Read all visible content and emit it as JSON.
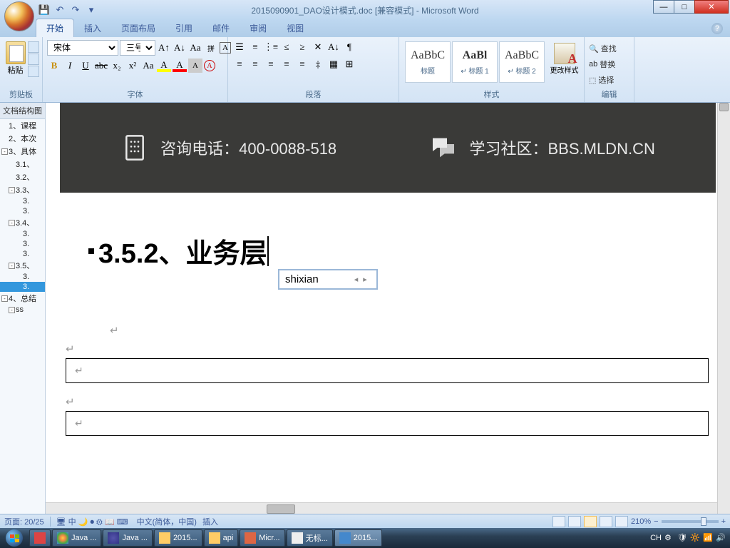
{
  "title": "2015090901_DAO设计模式.doc [兼容模式] - Microsoft Word",
  "ribbon": {
    "tabs": [
      "开始",
      "插入",
      "页面布局",
      "引用",
      "邮件",
      "审阅",
      "视图"
    ],
    "groups": {
      "clipboard": "剪贴板",
      "paste": "粘贴",
      "font": "字体",
      "paragraph": "段落",
      "styles": "样式",
      "editing": "编辑",
      "change_styles": "更改样式"
    },
    "font_name": "宋体",
    "font_size": "三号",
    "style_items": [
      {
        "preview": "AaBbC",
        "name": "标题"
      },
      {
        "preview": "AaBl",
        "name": "↵ 标题 1"
      },
      {
        "preview": "AaBbC",
        "name": "↵ 标题 2"
      }
    ],
    "find": "查找",
    "replace": "替换",
    "select": "选择"
  },
  "nav": {
    "title": "文档结构图",
    "items": [
      {
        "lvl": 0,
        "exp": "",
        "txt": "1、课程"
      },
      {
        "lvl": 0,
        "exp": "",
        "txt": "2、本次"
      },
      {
        "lvl": 0,
        "exp": "-",
        "txt": "3、具体"
      },
      {
        "lvl": 1,
        "exp": "",
        "txt": "3.1、"
      },
      {
        "lvl": 1,
        "exp": "",
        "txt": "3.2、"
      },
      {
        "lvl": 1,
        "exp": "-",
        "txt": "3.3、"
      },
      {
        "lvl": 2,
        "exp": "",
        "txt": "3."
      },
      {
        "lvl": 2,
        "exp": "",
        "txt": "3."
      },
      {
        "lvl": 1,
        "exp": "-",
        "txt": "3.4、"
      },
      {
        "lvl": 2,
        "exp": "",
        "txt": "3."
      },
      {
        "lvl": 2,
        "exp": "",
        "txt": "3."
      },
      {
        "lvl": 2,
        "exp": "",
        "txt": "3."
      },
      {
        "lvl": 1,
        "exp": "-",
        "txt": "3.5、"
      },
      {
        "lvl": 2,
        "exp": "",
        "txt": "3."
      },
      {
        "lvl": 2,
        "exp": "",
        "txt": "3.",
        "sel": true
      },
      {
        "lvl": 0,
        "exp": "-",
        "txt": "4、总结"
      },
      {
        "lvl": 1,
        "exp": "-",
        "txt": "ss"
      }
    ]
  },
  "banner": {
    "phone_label": "咨询电话：",
    "phone": "400-0088-518",
    "community_label": "学习社区：",
    "community": "BBS.MLDN.CN"
  },
  "document": {
    "heading": "3.5.2、业务层",
    "ime_input": "shixian"
  },
  "statusbar": {
    "page": "页面: 20/25",
    "lang": "中文(简体，中国)",
    "mode": "插入",
    "zoom": "210%"
  },
  "taskbar": {
    "items": [
      "",
      "Java ...",
      "Java ...",
      "2015...",
      "api",
      "Micr...",
      "无标...",
      "2015..."
    ],
    "time": "CH"
  }
}
